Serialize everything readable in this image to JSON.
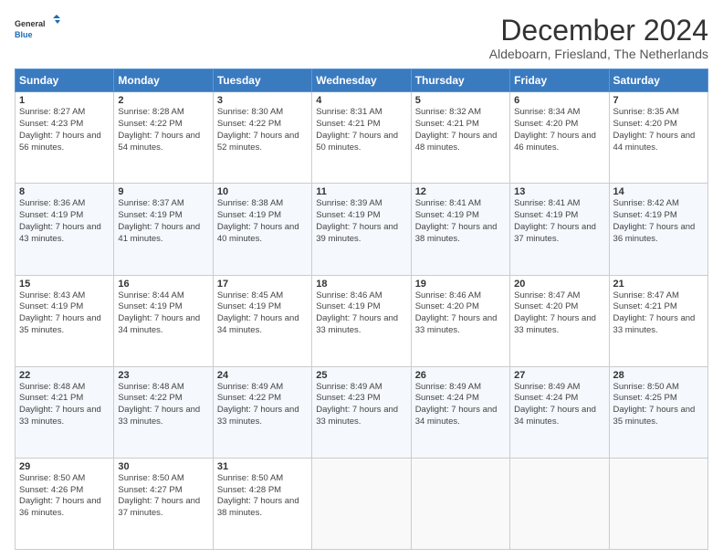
{
  "logo": {
    "line1": "General",
    "line2": "Blue"
  },
  "title": "December 2024",
  "subtitle": "Aldeboarn, Friesland, The Netherlands",
  "days_of_week": [
    "Sunday",
    "Monday",
    "Tuesday",
    "Wednesday",
    "Thursday",
    "Friday",
    "Saturday"
  ],
  "weeks": [
    [
      {
        "day": "1",
        "sunrise": "8:27 AM",
        "sunset": "4:23 PM",
        "daylight": "7 hours and 56 minutes."
      },
      {
        "day": "2",
        "sunrise": "8:28 AM",
        "sunset": "4:22 PM",
        "daylight": "7 hours and 54 minutes."
      },
      {
        "day": "3",
        "sunrise": "8:30 AM",
        "sunset": "4:22 PM",
        "daylight": "7 hours and 52 minutes."
      },
      {
        "day": "4",
        "sunrise": "8:31 AM",
        "sunset": "4:21 PM",
        "daylight": "7 hours and 50 minutes."
      },
      {
        "day": "5",
        "sunrise": "8:32 AM",
        "sunset": "4:21 PM",
        "daylight": "7 hours and 48 minutes."
      },
      {
        "day": "6",
        "sunrise": "8:34 AM",
        "sunset": "4:20 PM",
        "daylight": "7 hours and 46 minutes."
      },
      {
        "day": "7",
        "sunrise": "8:35 AM",
        "sunset": "4:20 PM",
        "daylight": "7 hours and 44 minutes."
      }
    ],
    [
      {
        "day": "8",
        "sunrise": "8:36 AM",
        "sunset": "4:19 PM",
        "daylight": "7 hours and 43 minutes."
      },
      {
        "day": "9",
        "sunrise": "8:37 AM",
        "sunset": "4:19 PM",
        "daylight": "7 hours and 41 minutes."
      },
      {
        "day": "10",
        "sunrise": "8:38 AM",
        "sunset": "4:19 PM",
        "daylight": "7 hours and 40 minutes."
      },
      {
        "day": "11",
        "sunrise": "8:39 AM",
        "sunset": "4:19 PM",
        "daylight": "7 hours and 39 minutes."
      },
      {
        "day": "12",
        "sunrise": "8:41 AM",
        "sunset": "4:19 PM",
        "daylight": "7 hours and 38 minutes."
      },
      {
        "day": "13",
        "sunrise": "8:41 AM",
        "sunset": "4:19 PM",
        "daylight": "7 hours and 37 minutes."
      },
      {
        "day": "14",
        "sunrise": "8:42 AM",
        "sunset": "4:19 PM",
        "daylight": "7 hours and 36 minutes."
      }
    ],
    [
      {
        "day": "15",
        "sunrise": "8:43 AM",
        "sunset": "4:19 PM",
        "daylight": "7 hours and 35 minutes."
      },
      {
        "day": "16",
        "sunrise": "8:44 AM",
        "sunset": "4:19 PM",
        "daylight": "7 hours and 34 minutes."
      },
      {
        "day": "17",
        "sunrise": "8:45 AM",
        "sunset": "4:19 PM",
        "daylight": "7 hours and 34 minutes."
      },
      {
        "day": "18",
        "sunrise": "8:46 AM",
        "sunset": "4:19 PM",
        "daylight": "7 hours and 33 minutes."
      },
      {
        "day": "19",
        "sunrise": "8:46 AM",
        "sunset": "4:20 PM",
        "daylight": "7 hours and 33 minutes."
      },
      {
        "day": "20",
        "sunrise": "8:47 AM",
        "sunset": "4:20 PM",
        "daylight": "7 hours and 33 minutes."
      },
      {
        "day": "21",
        "sunrise": "8:47 AM",
        "sunset": "4:21 PM",
        "daylight": "7 hours and 33 minutes."
      }
    ],
    [
      {
        "day": "22",
        "sunrise": "8:48 AM",
        "sunset": "4:21 PM",
        "daylight": "7 hours and 33 minutes."
      },
      {
        "day": "23",
        "sunrise": "8:48 AM",
        "sunset": "4:22 PM",
        "daylight": "7 hours and 33 minutes."
      },
      {
        "day": "24",
        "sunrise": "8:49 AM",
        "sunset": "4:22 PM",
        "daylight": "7 hours and 33 minutes."
      },
      {
        "day": "25",
        "sunrise": "8:49 AM",
        "sunset": "4:23 PM",
        "daylight": "7 hours and 33 minutes."
      },
      {
        "day": "26",
        "sunrise": "8:49 AM",
        "sunset": "4:24 PM",
        "daylight": "7 hours and 34 minutes."
      },
      {
        "day": "27",
        "sunrise": "8:49 AM",
        "sunset": "4:24 PM",
        "daylight": "7 hours and 34 minutes."
      },
      {
        "day": "28",
        "sunrise": "8:50 AM",
        "sunset": "4:25 PM",
        "daylight": "7 hours and 35 minutes."
      }
    ],
    [
      {
        "day": "29",
        "sunrise": "8:50 AM",
        "sunset": "4:26 PM",
        "daylight": "7 hours and 36 minutes."
      },
      {
        "day": "30",
        "sunrise": "8:50 AM",
        "sunset": "4:27 PM",
        "daylight": "7 hours and 37 minutes."
      },
      {
        "day": "31",
        "sunrise": "8:50 AM",
        "sunset": "4:28 PM",
        "daylight": "7 hours and 38 minutes."
      },
      null,
      null,
      null,
      null
    ]
  ]
}
